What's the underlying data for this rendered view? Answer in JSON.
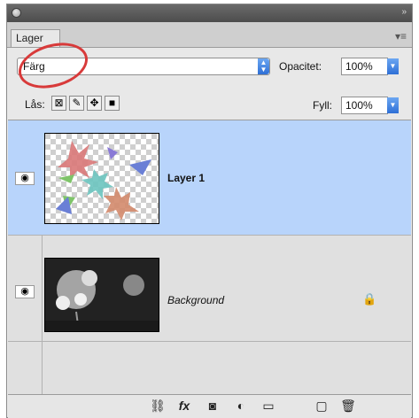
{
  "window": {
    "collapse_icon": "»",
    "colors": {
      "titlebar": "#5a5a5a",
      "selection": "#b8d4fb",
      "accent": "#2e6fd6",
      "annotation": "#d83a3a"
    }
  },
  "tabs": [
    {
      "label": "Lager"
    }
  ],
  "controls": {
    "blend_mode": "Färg",
    "opacity_label": "Opacitet:",
    "opacity_value": "100%",
    "lock_label": "Lås:",
    "fill_label": "Fyll:",
    "fill_value": "100%",
    "lock_buttons": [
      "lock-transparent-pixels-icon",
      "lock-image-pixels-icon",
      "lock-position-icon",
      "lock-all-icon"
    ]
  },
  "layers": [
    {
      "name": "Layer 1",
      "visible": true,
      "selected": true,
      "thumbnail": "colored-shapes-on-transparency"
    },
    {
      "name": "Background",
      "visible": true,
      "selected": false,
      "locked": true,
      "thumbnail": "grayscale-flower-photo"
    }
  ],
  "bottom_toolbar": [
    "link-layers-icon",
    "layer-style-fx-icon",
    "layer-mask-icon",
    "adjustment-layer-icon",
    "new-group-icon",
    "new-layer-icon",
    "delete-layer-icon"
  ]
}
